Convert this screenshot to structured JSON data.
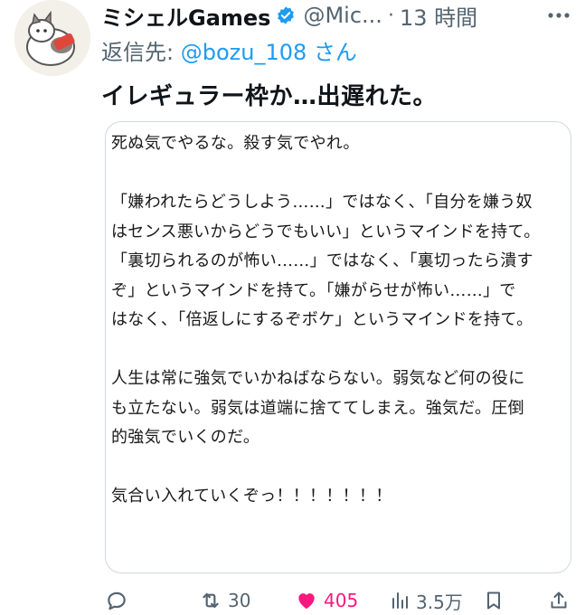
{
  "tweet": {
    "display_name": "ミシェルGames",
    "handle": "@Mic...",
    "separator": "·",
    "time": "13 時間",
    "reply_prefix": "返信先: ",
    "reply_to": "@bozu_108 さん",
    "text": "イレギュラー枠か…出遅れた。"
  },
  "image_text": {
    "lines": [
      "死ぬ気でやるな。殺す気でやれ。",
      "",
      "「嫌われたらどうしよう……」ではなく、「自分を嫌う奴",
      "はセンス悪いからどうでもいい」というマインドを持て。",
      "「裏切られるのが怖い……」ではなく、「裏切ったら潰す",
      "ぞ」というマインドを持て。「嫌がらせが怖い……」で",
      "はなく、「倍返しにするぞボケ」というマインドを持て。",
      "",
      "人生は常に強気でいかねばならない。弱気など何の役に",
      "も立たない。弱気は道端に捨ててしまえ。強気だ。圧倒",
      "的強気でいくのだ。",
      "",
      "気合い入れていくぞっ！！！！！！！"
    ]
  },
  "actions": {
    "reply_count": "",
    "retweet_count": "30",
    "like_count": "405",
    "views_count": "3.5万"
  },
  "colors": {
    "accent": "#1d9bf0",
    "like": "#f91880",
    "muted": "#536471",
    "text": "#0f1419"
  },
  "icons": {
    "verified": "verified-badge-icon",
    "more": "more-dots-icon",
    "reply": "reply-bubble-icon",
    "retweet": "retweet-icon",
    "like": "heart-icon",
    "views": "views-bars-icon",
    "bookmark": "bookmark-icon",
    "share": "share-icon"
  }
}
